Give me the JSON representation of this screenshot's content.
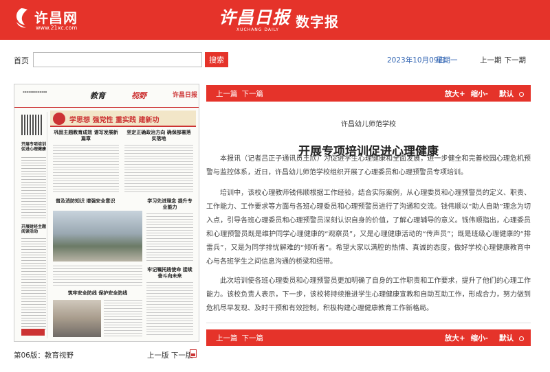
{
  "header": {
    "site_name": "许昌网",
    "site_url": "www.21xc.com",
    "paper_name": "许昌日报",
    "paper_name_en": "XUCHANG DAILY",
    "digital_label": "数字报",
    "brand_color": "#e5332a"
  },
  "toolbar": {
    "home_label": "首页",
    "search_placeholder": "",
    "search_button": "搜索",
    "date": "2023年10月09日",
    "weekday": "星期一",
    "prev_edition": "上一期",
    "next_edition": "下一期"
  },
  "page_thumbnail": {
    "section_name": "教育",
    "section_sub": "视野",
    "brand": "许昌日报",
    "banner_text": "学思想 强党性 重实践 建新功",
    "headlines": [
      "巩固主题教育成效 谱写发展新篇章",
      "坚定正确政治方向 确保部署落实落地",
      "普及消防知识 增强安全意识",
      "学习先进理念 提升专业能力",
      "牢记嘱托践使命 接续奋斗向未来",
      "筑牢安全防线 保护安全防线"
    ],
    "sidebar_titles": [
      "开展专项培训 促进心理健康",
      "开展财经主题 阅读活动"
    ]
  },
  "page_label": "第06版：教育视野",
  "page_nav": {
    "prev_page": "上一版",
    "next_page": "下一版"
  },
  "article_bar": {
    "prev": "上一篇",
    "next": "下一篇",
    "zoom_in": "放大+",
    "zoom_out": "缩小-",
    "reset": "默认"
  },
  "article": {
    "kicker": "许昌幼儿师范学校",
    "title": "开展专项培训促进心理健康",
    "paragraphs": [
      "本报讯（记者吕正子通讯员王欣）为促进学生心理健康和全面发展，进一步健全和完善校园心理危机预警与监控体系，近日，许昌幼儿师范学校组织开展了心理委员和心理预警员专项培训。",
      "培训中，该校心理教师钱伟顺根据工作经验，结合实际案例，从心理委员和心理预警员的定义、职责、工作能力、工作要求等方面与各班心理委员和心理预警员进行了沟通和交流。钱伟顺以“助人自助”理念为切入点，引导各班心理委员和心理预警员深刻认识自身的价值，了解心理辅导的意义。钱伟顺指出，心理委员和心理预警员既是维护同学心理健康的“观察员”，又是心理健康活动的“传声员”；既是班级心理健康的“排雷兵”，又是为同学排忧解难的“倾听者”。希望大家以满腔的热情、真诚的态度，做好学校心理健康教育中心与各班学生之间信息沟通的桥梁和纽带。",
      "此次培训使各班心理委员和心理预警员更加明确了自身的工作职责和工作要求，提升了他们的心理工作能力。该校负责人表示，下一步，该校将持续推进学生心理健康宣教和自助互助工作，形成合力，努力做到危机尽早发现、及时干预和有效控制，积极构建心理健康教育工作新格局。"
    ]
  }
}
